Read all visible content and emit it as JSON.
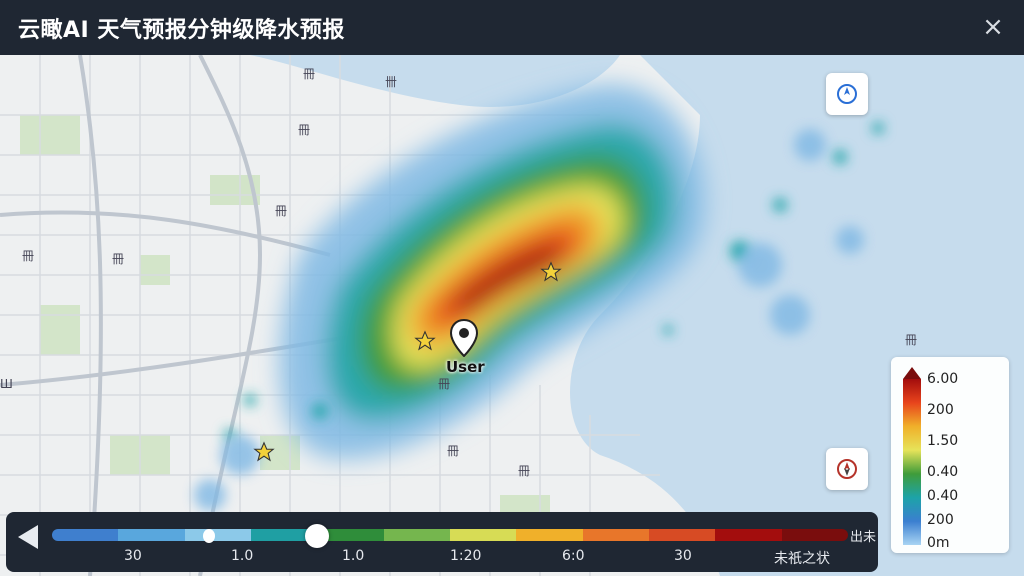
{
  "title": "云瞰AI 天气预报分钟级降水预报",
  "close_icon": "×",
  "map": {
    "labels": [
      "Ш",
      "冊",
      "卌",
      "冊",
      "冊",
      "冊",
      "冊",
      "冊",
      "冊",
      "冊",
      "冊",
      "冊",
      "冊",
      "冊"
    ],
    "user_label": "User"
  },
  "legend": {
    "values": [
      "6.00",
      "200",
      "1.50",
      "0.40",
      "0.40",
      "200",
      "0m"
    ],
    "colors": [
      "#a30d0d",
      "#e8441c",
      "#f0b02a",
      "#e6e35a",
      "#3f9c3a",
      "#1da3a8",
      "#3b7fd0",
      "#a8d4f3"
    ]
  },
  "timeline": {
    "ticks": [
      "30",
      "1.0",
      "1.0",
      "1:20",
      "6:0",
      "30",
      "未祇之状"
    ],
    "cap": "出未",
    "colors": [
      "#3f7fce",
      "#59a7dd",
      "#8cc9e9",
      "#1f9fa3",
      "#2f8d3a",
      "#75b64e",
      "#d7dc55",
      "#f0b02a",
      "#e8762a",
      "#d74b24",
      "#a30d0d",
      "#7a0d0d"
    ]
  },
  "icons": {
    "compass": "compass-icon",
    "location": "location-icon",
    "play": "play-icon",
    "star": "star-icon",
    "pin": "map-pin-icon"
  }
}
